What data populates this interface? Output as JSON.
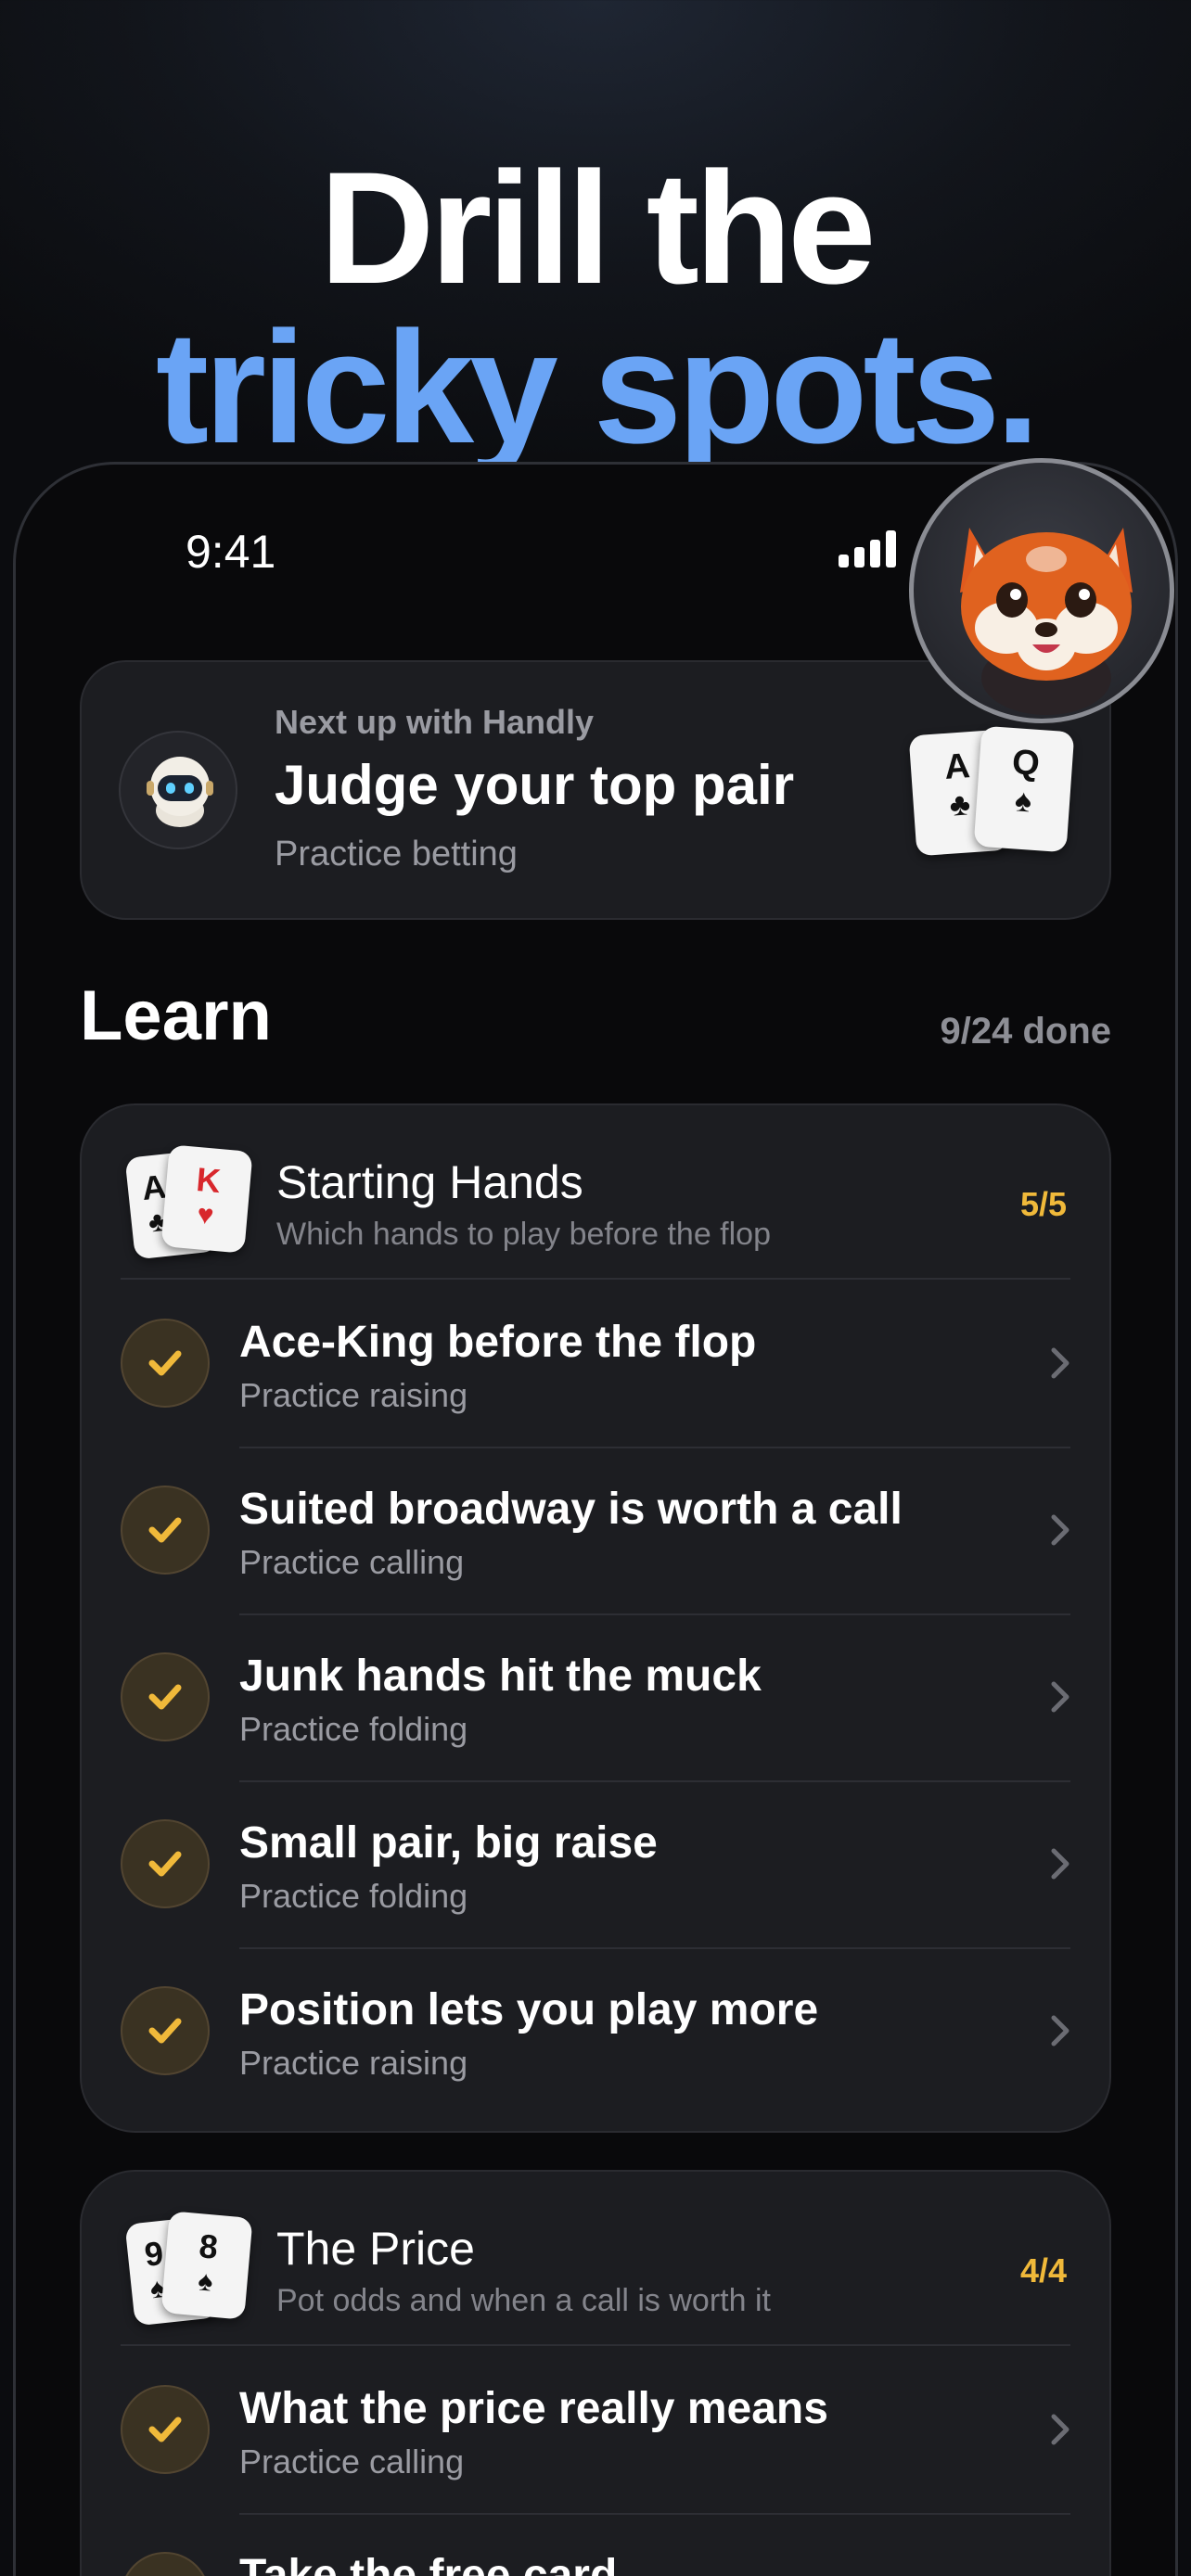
{
  "headline": {
    "line1": "Drill the",
    "line2": "tricky spots."
  },
  "status_bar": {
    "time": "9:41"
  },
  "mascot": {
    "icon": "red-panda-mascot-icon"
  },
  "next_up": {
    "label": "Next up with Handly",
    "title": "Judge your top pair",
    "subtitle": "Practice betting",
    "icon": "robot-icon",
    "cards": [
      {
        "rank": "A",
        "suit": "♣",
        "color": "#111111"
      },
      {
        "rank": "Q",
        "suit": "♠",
        "color": "#111111"
      }
    ]
  },
  "learn": {
    "title": "Learn",
    "progress": "9/24 done",
    "sections": [
      {
        "title": "Starting Hands",
        "subtitle": "Which hands to play before the flop",
        "count": "5/5",
        "cards": [
          {
            "rank": "A",
            "suit": "♣",
            "color": "#111111"
          },
          {
            "rank": "K",
            "suit": "♥",
            "color": "#d8272c"
          }
        ],
        "items": [
          {
            "title": "Ace-King before the flop",
            "subtitle": "Practice raising"
          },
          {
            "title": "Suited broadway is worth a call",
            "subtitle": "Practice calling"
          },
          {
            "title": "Junk hands hit the muck",
            "subtitle": "Practice folding"
          },
          {
            "title": "Small pair, big raise",
            "subtitle": "Practice folding"
          },
          {
            "title": "Position lets you play more",
            "subtitle": "Practice raising"
          }
        ]
      },
      {
        "title": "The Price",
        "subtitle": "Pot odds and when a call is worth it",
        "count": "4/4",
        "cards": [
          {
            "rank": "9",
            "suit": "♠",
            "color": "#111111"
          },
          {
            "rank": "8",
            "suit": "♠",
            "color": "#111111"
          }
        ],
        "items": [
          {
            "title": "What the price really means",
            "subtitle": "Practice calling"
          },
          {
            "title": "Take the free card",
            "subtitle": ""
          }
        ]
      }
    ]
  },
  "colors": {
    "accent_blue": "#6aa4f5",
    "accent_gold": "#f0b93a",
    "card_bg": "#1c1d21"
  }
}
